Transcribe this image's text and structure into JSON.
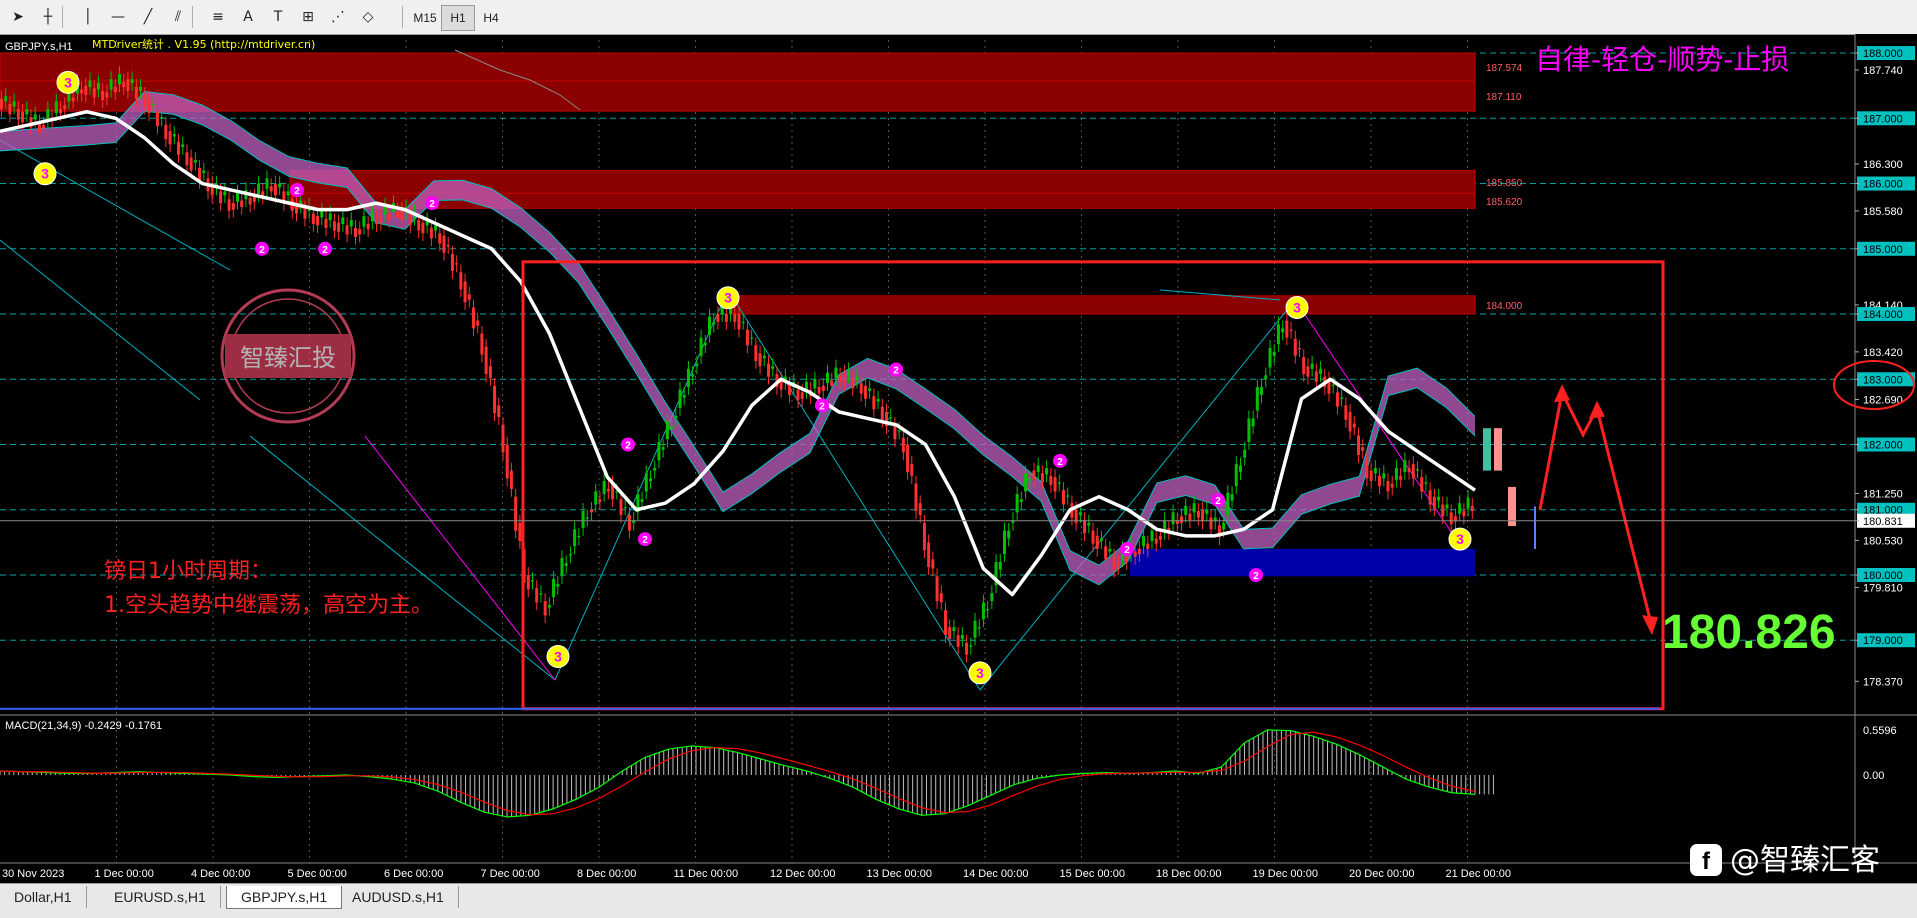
{
  "toolbar": {
    "buttons": [
      {
        "name": "cursor-icon",
        "glyph": "➤"
      },
      {
        "name": "crosshair-icon",
        "glyph": "┼"
      },
      {
        "name": "vertical-line-icon",
        "glyph": "│"
      },
      {
        "name": "horizontal-line-icon",
        "glyph": "—"
      },
      {
        "name": "trendline-icon",
        "glyph": "╱"
      },
      {
        "name": "channel-icon",
        "glyph": "⫽"
      },
      {
        "name": "fibonacci-icon",
        "glyph": "≡"
      },
      {
        "name": "text-icon",
        "glyph": "A"
      },
      {
        "name": "text-label-icon",
        "glyph": "T"
      },
      {
        "name": "gann-icon",
        "glyph": "⊞"
      },
      {
        "name": "fib-fan-icon",
        "glyph": "⋰"
      },
      {
        "name": "shapes-icon",
        "glyph": "◇"
      }
    ],
    "timeframes": [
      "M15",
      "H1",
      "H4"
    ],
    "active_timeframe": "H1"
  },
  "chart_header": {
    "symbol": "GBPJPY.s,H1",
    "indicator": "MTDriver统计 . V1.95 (http://mtdriver.cn)"
  },
  "motto": "自律-轻仓-顺势-止损",
  "watermark": "智臻汇投",
  "analysis": {
    "line1": "镑日1小时周期：",
    "line2": "1.空头趋势中继震荡，高空为主。"
  },
  "big_price": "180.826",
  "brand": "@智臻汇客",
  "colors": {
    "background": "#000000",
    "bull": "#00c000",
    "bear": "#ff3030",
    "ma": "#ffffff",
    "zone": "#8b0000",
    "support_zone": "#0000a8",
    "box": "#ff2020",
    "accent": "#ff00ff",
    "grid": "#00a0a0",
    "macd_line": "#00ff00",
    "signal_line": "#ff0000"
  },
  "chart_data": {
    "type": "candlestick",
    "symbol": "GBPJPY.s",
    "timeframe": "H1",
    "x_labels": [
      "30 Nov 2023",
      "1 Dec 00:00",
      "4 Dec 00:00",
      "5 Dec 00:00",
      "6 Dec 00:00",
      "7 Dec 00:00",
      "8 Dec 00:00",
      "11 Dec 00:00",
      "12 Dec 00:00",
      "13 Dec 00:00",
      "14 Dec 00:00",
      "15 Dec 00:00",
      "18 Dec 00:00",
      "19 Dec 00:00",
      "20 Dec 00:00",
      "21 Dec 00:00"
    ],
    "ylim": [
      177.9,
      188.2
    ],
    "y_ticks": [
      "188.000",
      "187.740",
      "187.000",
      "186.300",
      "186.000",
      "185.580",
      "185.000",
      "184.140",
      "184.000",
      "183.420",
      "183.000",
      "182.690",
      "182.000",
      "181.250",
      "181.000",
      "180.831",
      "180.530",
      "180.000",
      "179.810",
      "179.000",
      "178.370"
    ],
    "highlight_ticks": [
      "188.000",
      "187.000",
      "186.000",
      "185.000",
      "184.000",
      "183.000",
      "182.000",
      "181.000",
      "180.831",
      "180.000",
      "179.000"
    ],
    "current_price": 180.831,
    "resistance_zones": [
      {
        "from": 187.57,
        "to": 188.0,
        "label": "187.574"
      },
      {
        "from": 187.11,
        "to": 187.57,
        "label": "187.110"
      },
      {
        "from": 185.85,
        "to": 186.2,
        "label": "185.850"
      },
      {
        "from": 185.62,
        "to": 185.85,
        "label": "185.620"
      },
      {
        "from": 184.0,
        "to": 184.28,
        "label": "184.000"
      }
    ],
    "support_zone": {
      "from": 179.98,
      "to": 180.4
    },
    "box": {
      "x_from": "7 Dec 00:00",
      "x_to": "21 Dec 20:00",
      "y_from": 177.95,
      "y_to": 184.8
    },
    "swing_points": [
      {
        "x": "1 Dec",
        "y": 187.55,
        "label": "3"
      },
      {
        "x": "30 Nov",
        "y": 186.15,
        "label": "3"
      },
      {
        "x": "5 Dec",
        "y": 185.9,
        "label": "2"
      },
      {
        "x": "4 Dec",
        "y": 185.0,
        "label": "2"
      },
      {
        "x": "5 Dec",
        "y": 185.0,
        "label": "2"
      },
      {
        "x": "6 Dec",
        "y": 185.7,
        "label": "2"
      },
      {
        "x": "7 Dec",
        "y": 178.75,
        "label": "3"
      },
      {
        "x": "8 Dec",
        "y": 182.0,
        "label": "2"
      },
      {
        "x": "8 Dec",
        "y": 180.55,
        "label": "2"
      },
      {
        "x": "11 Dec",
        "y": 184.25,
        "label": "3"
      },
      {
        "x": "12 Dec",
        "y": 182.6,
        "label": "2"
      },
      {
        "x": "13 Dec",
        "y": 183.15,
        "label": "2"
      },
      {
        "x": "14 Dec",
        "y": 178.5,
        "label": "3"
      },
      {
        "x": "15 Dec",
        "y": 181.75,
        "label": "2"
      },
      {
        "x": "18 Dec",
        "y": 180.4,
        "label": "2"
      },
      {
        "x": "18 Dec",
        "y": 181.15,
        "label": "2"
      },
      {
        "x": "19 Dec",
        "y": 180.0,
        "label": "2"
      },
      {
        "x": "19 Dec",
        "y": 184.1,
        "label": "3"
      },
      {
        "x": "21 Dec",
        "y": 180.55,
        "label": "3"
      }
    ],
    "close_series": [
      187.3,
      187.1,
      186.9,
      187.2,
      187.5,
      187.4,
      187.6,
      187.3,
      186.8,
      186.4,
      186.0,
      185.7,
      185.8,
      186.0,
      185.7,
      185.5,
      185.4,
      185.3,
      185.5,
      185.6,
      185.4,
      185.2,
      184.5,
      183.5,
      182.0,
      180.0,
      179.5,
      180.3,
      181.0,
      181.4,
      180.8,
      181.6,
      182.4,
      183.2,
      184.0,
      184.0,
      183.4,
      183.0,
      182.8,
      182.9,
      183.1,
      182.9,
      182.5,
      182.0,
      180.5,
      179.2,
      178.9,
      179.6,
      180.8,
      181.6,
      181.5,
      181.0,
      180.6,
      180.2,
      180.4,
      180.6,
      180.9,
      181.0,
      180.7,
      181.8,
      183.0,
      183.9,
      183.2,
      183.0,
      182.5,
      181.6,
      181.4,
      181.7,
      181.2,
      180.9,
      181.1
    ],
    "ma_series": [
      186.8,
      186.9,
      187.0,
      187.1,
      187.0,
      186.7,
      186.3,
      186.0,
      185.9,
      185.8,
      185.7,
      185.6,
      185.6,
      185.7,
      185.6,
      185.4,
      185.2,
      185.0,
      184.5,
      183.7,
      182.6,
      181.5,
      181.0,
      181.1,
      181.4,
      181.9,
      182.6,
      183.0,
      182.8,
      182.5,
      182.4,
      182.3,
      182.0,
      181.2,
      180.1,
      179.7,
      180.3,
      181.0,
      181.2,
      181.0,
      180.7,
      180.6,
      180.6,
      180.7,
      181.0,
      182.7,
      183.0,
      182.7,
      182.2,
      181.9,
      181.6,
      181.3
    ],
    "projection": [
      {
        "x": "21 Dec 21:00",
        "y": 181.0
      },
      {
        "x": "22 Dec 01:00",
        "y": 182.8
      },
      {
        "x": "22 Dec 04:00",
        "y": 182.15
      },
      {
        "x": "22 Dec 06:00",
        "y": 182.55
      },
      {
        "x": "22 Dec 12:00",
        "y": 179.2
      }
    ],
    "macd": {
      "params": "MACD(21,34,9)",
      "values": "-0.2429 -0.1761",
      "ylim": [
        -0.62,
        0.62
      ],
      "y_ticks": [
        "0.5596",
        "0.00"
      ],
      "histogram": [
        0.05,
        0.04,
        0.03,
        0.02,
        0.02,
        0.03,
        0.04,
        0.03,
        0.02,
        0.01,
        0.0,
        -0.02,
        -0.03,
        -0.02,
        -0.01,
        0.0,
        -0.02,
        -0.05,
        -0.1,
        -0.2,
        -0.34,
        -0.46,
        -0.52,
        -0.5,
        -0.42,
        -0.3,
        -0.15,
        0.05,
        0.22,
        0.32,
        0.36,
        0.34,
        0.28,
        0.2,
        0.12,
        0.05,
        -0.04,
        -0.15,
        -0.3,
        -0.42,
        -0.5,
        -0.48,
        -0.38,
        -0.25,
        -0.12,
        -0.04,
        0.0,
        0.02,
        0.03,
        0.02,
        0.03,
        0.05,
        0.02,
        0.1,
        0.4,
        0.56,
        0.55,
        0.48,
        0.38,
        0.25,
        0.1,
        -0.05,
        -0.15,
        -0.22,
        -0.24
      ]
    }
  }
}
